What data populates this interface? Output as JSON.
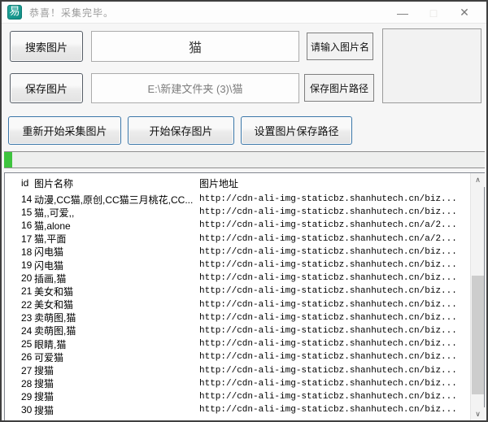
{
  "window": {
    "title": "恭喜！采集完毕。",
    "app_icon_glyph": "易",
    "controls": {
      "minimize": "—",
      "maximize": "□",
      "close": "✕"
    }
  },
  "toolbar": {
    "search_button": "搜索图片",
    "save_button": "保存图片",
    "restart_button": "重新开始采集图片",
    "start_save_button": "开始保存图片",
    "set_path_button": "设置图片保存路径",
    "keyword_value": "猫",
    "keyword_hint": "请输入图片名",
    "path_value": "E:\\新建文件夹 (3)\\猫",
    "path_hint": "保存图片路径"
  },
  "progress": {
    "percent": 1.7
  },
  "scrollbar": {
    "up_glyph": "∧",
    "down_glyph": "∨"
  },
  "colors": {
    "logo_teal": "#159a90",
    "button_blue_border": "#3a76a8",
    "progress_green": "#3ec43e"
  },
  "table": {
    "columns": [
      "id",
      "图片名称",
      "图片地址"
    ],
    "rows": [
      {
        "id": "14",
        "name": "动漫,CC猫,原创,CC猫三月桃花,CC...",
        "url": "http://cdn-ali-img-staticbz.shanhutech.cn/biz..."
      },
      {
        "id": "15",
        "name": "猫,,可爱,,",
        "url": "http://cdn-ali-img-staticbz.shanhutech.cn/biz..."
      },
      {
        "id": "16",
        "name": "猫,alone",
        "url": "http://cdn-ali-img-staticbz.shanhutech.cn/a/2..."
      },
      {
        "id": "17",
        "name": "猫,平面",
        "url": "http://cdn-ali-img-staticbz.shanhutech.cn/a/2..."
      },
      {
        "id": "18",
        "name": "闪电猫",
        "url": "http://cdn-ali-img-staticbz.shanhutech.cn/biz..."
      },
      {
        "id": "19",
        "name": "闪电猫",
        "url": "http://cdn-ali-img-staticbz.shanhutech.cn/biz..."
      },
      {
        "id": "20",
        "name": "插画,猫",
        "url": "http://cdn-ali-img-staticbz.shanhutech.cn/biz..."
      },
      {
        "id": "21",
        "name": "美女和猫",
        "url": "http://cdn-ali-img-staticbz.shanhutech.cn/biz..."
      },
      {
        "id": "22",
        "name": "美女和猫",
        "url": "http://cdn-ali-img-staticbz.shanhutech.cn/biz..."
      },
      {
        "id": "23",
        "name": "卖萌图,猫",
        "url": "http://cdn-ali-img-staticbz.shanhutech.cn/biz..."
      },
      {
        "id": "24",
        "name": "卖萌图,猫",
        "url": "http://cdn-ali-img-staticbz.shanhutech.cn/biz..."
      },
      {
        "id": "25",
        "name": "眼睛,猫",
        "url": "http://cdn-ali-img-staticbz.shanhutech.cn/biz..."
      },
      {
        "id": "26",
        "name": "可爱猫",
        "url": "http://cdn-ali-img-staticbz.shanhutech.cn/biz..."
      },
      {
        "id": "27",
        "name": "搜猫",
        "url": "http://cdn-ali-img-staticbz.shanhutech.cn/biz..."
      },
      {
        "id": "28",
        "name": "搜猫",
        "url": "http://cdn-ali-img-staticbz.shanhutech.cn/biz..."
      },
      {
        "id": "29",
        "name": "搜猫",
        "url": "http://cdn-ali-img-staticbz.shanhutech.cn/biz..."
      },
      {
        "id": "30",
        "name": "搜猫",
        "url": "http://cdn-ali-img-staticbz.shanhutech.cn/biz..."
      }
    ]
  }
}
